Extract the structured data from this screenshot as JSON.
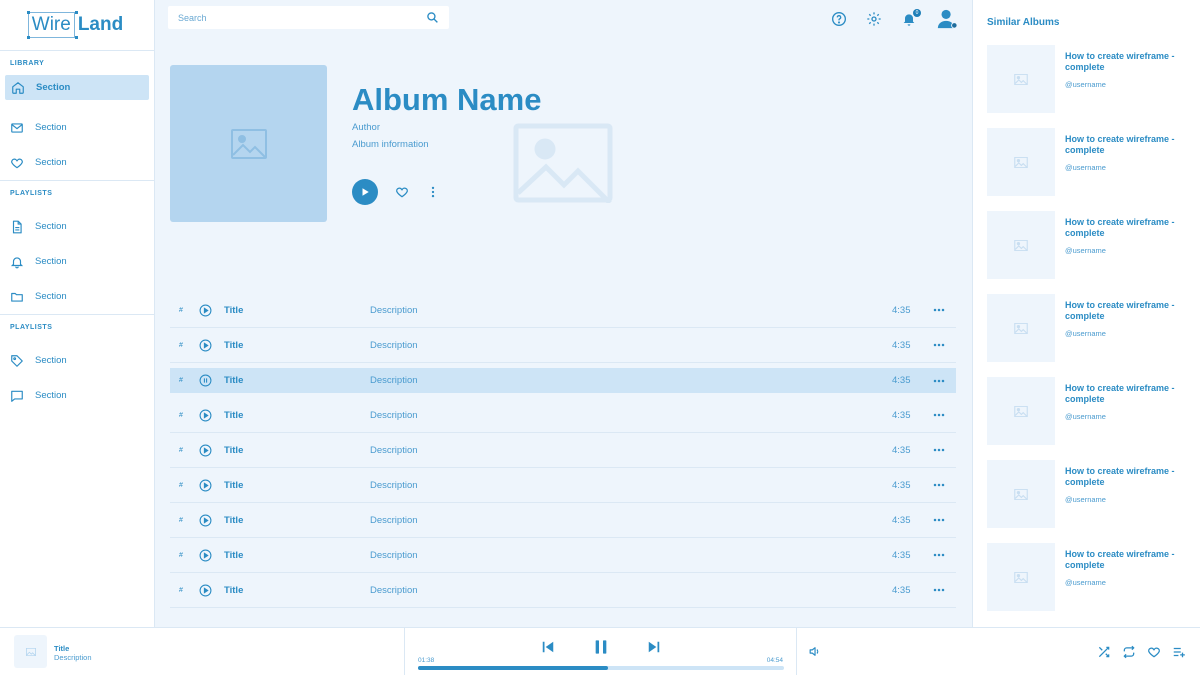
{
  "brand": {
    "part1": "Wire",
    "part2": "Land"
  },
  "colors": {
    "accent": "#2b8cc4",
    "light": "#cde4f6",
    "bg": "#eef5fc"
  },
  "sidebar": {
    "groups": [
      {
        "heading": "LIBRARY",
        "items": [
          {
            "label": "Section",
            "icon": "home-icon",
            "active": true
          },
          {
            "label": "Section",
            "icon": "mail-icon"
          },
          {
            "label": "Section",
            "icon": "heart-icon"
          }
        ]
      },
      {
        "heading": "PLAYLISTS",
        "items": [
          {
            "label": "Section",
            "icon": "file-icon"
          },
          {
            "label": "Section",
            "icon": "bell-icon"
          },
          {
            "label": "Section",
            "icon": "folder-icon"
          }
        ]
      },
      {
        "heading": "PLAYLISTS",
        "items": [
          {
            "label": "Section",
            "icon": "tag-icon"
          },
          {
            "label": "Section",
            "icon": "chat-icon"
          }
        ]
      }
    ]
  },
  "search": {
    "placeholder": "Search"
  },
  "header": {
    "notification_count": "0"
  },
  "album": {
    "title": "Album Name",
    "author": "Author",
    "info": "Album information"
  },
  "tracks": [
    {
      "num": "#",
      "title": "Title",
      "description": "Description",
      "duration": "4:35",
      "state": "play"
    },
    {
      "num": "#",
      "title": "Title",
      "description": "Description",
      "duration": "4:35",
      "state": "play"
    },
    {
      "num": "#",
      "title": "Title",
      "description": "Description",
      "duration": "4:35",
      "state": "pause"
    },
    {
      "num": "#",
      "title": "Title",
      "description": "Description",
      "duration": "4:35",
      "state": "play"
    },
    {
      "num": "#",
      "title": "Title",
      "description": "Description",
      "duration": "4:35",
      "state": "play"
    },
    {
      "num": "#",
      "title": "Title",
      "description": "Description",
      "duration": "4:35",
      "state": "play"
    },
    {
      "num": "#",
      "title": "Title",
      "description": "Description",
      "duration": "4:35",
      "state": "play"
    },
    {
      "num": "#",
      "title": "Title",
      "description": "Description",
      "duration": "4:35",
      "state": "play"
    },
    {
      "num": "#",
      "title": "Title",
      "description": "Description",
      "duration": "4:35",
      "state": "play"
    }
  ],
  "similar": {
    "title": "Similar Albums",
    "items": [
      {
        "title": "How to create wireframe - complete",
        "user": "@username"
      },
      {
        "title": "How to create wireframe - complete",
        "user": "@username"
      },
      {
        "title": "How to create wireframe - complete",
        "user": "@username"
      },
      {
        "title": "How to create wireframe - complete",
        "user": "@username"
      },
      {
        "title": "How to create wireframe - complete",
        "user": "@username"
      },
      {
        "title": "How to create wireframe - complete",
        "user": "@username"
      },
      {
        "title": "How to create wireframe - complete",
        "user": "@username"
      }
    ]
  },
  "player": {
    "title": "Title",
    "description": "Description",
    "current_time": "01:38",
    "total_time": "04:54",
    "progress_fraction": 0.52
  }
}
